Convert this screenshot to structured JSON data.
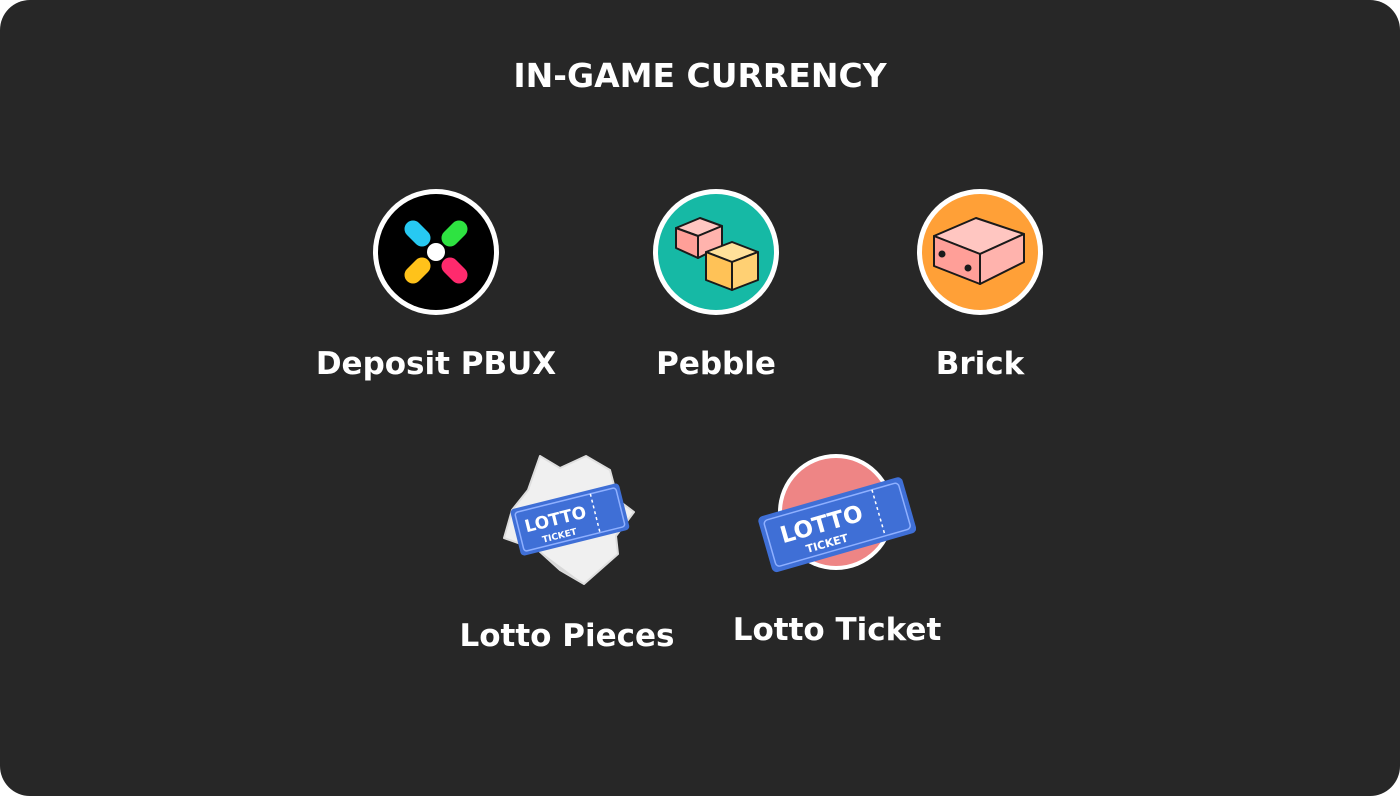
{
  "title": "IN-GAME CURRENCY",
  "currencies": [
    {
      "label": "Deposit PBUX",
      "icon": "pbux-icon"
    },
    {
      "label": "Pebble",
      "icon": "pebble-icon"
    },
    {
      "label": "Brick",
      "icon": "brick-icon"
    },
    {
      "label": "Lotto Pieces",
      "icon": "lotto-pieces-icon"
    },
    {
      "label": "Lotto Ticket",
      "icon": "lotto-ticket-icon"
    }
  ],
  "ticket": {
    "line1": "LOTTO",
    "line2": "TICKET"
  },
  "colors": {
    "background": "#272727",
    "pebble_bg": "#16b9a5",
    "brick_bg": "#ffa037",
    "pink_block": "#ffb3ad",
    "yellow_block": "#ffd073",
    "ticket_blue": "#3f6fd6",
    "lotto_circle": "#ee8585"
  }
}
